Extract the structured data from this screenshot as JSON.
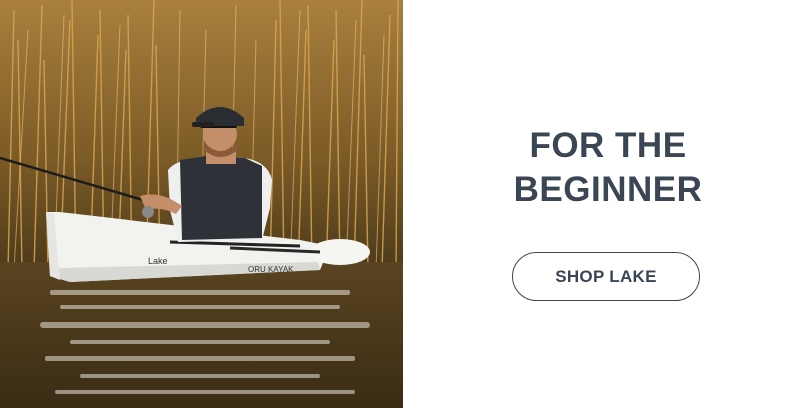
{
  "promo": {
    "headline_line1": "FOR THE",
    "headline_line2": "BEGINNER",
    "cta_label": "SHOP LAKE"
  },
  "photo": {
    "kayak_model_text": "Lake",
    "kayak_brand_text": "ORU KAYAK",
    "icons": [
      "kayak-photo",
      "oru-logo"
    ]
  },
  "colors": {
    "text": "#3a4654",
    "border": "#3a4654",
    "background": "#ffffff"
  }
}
